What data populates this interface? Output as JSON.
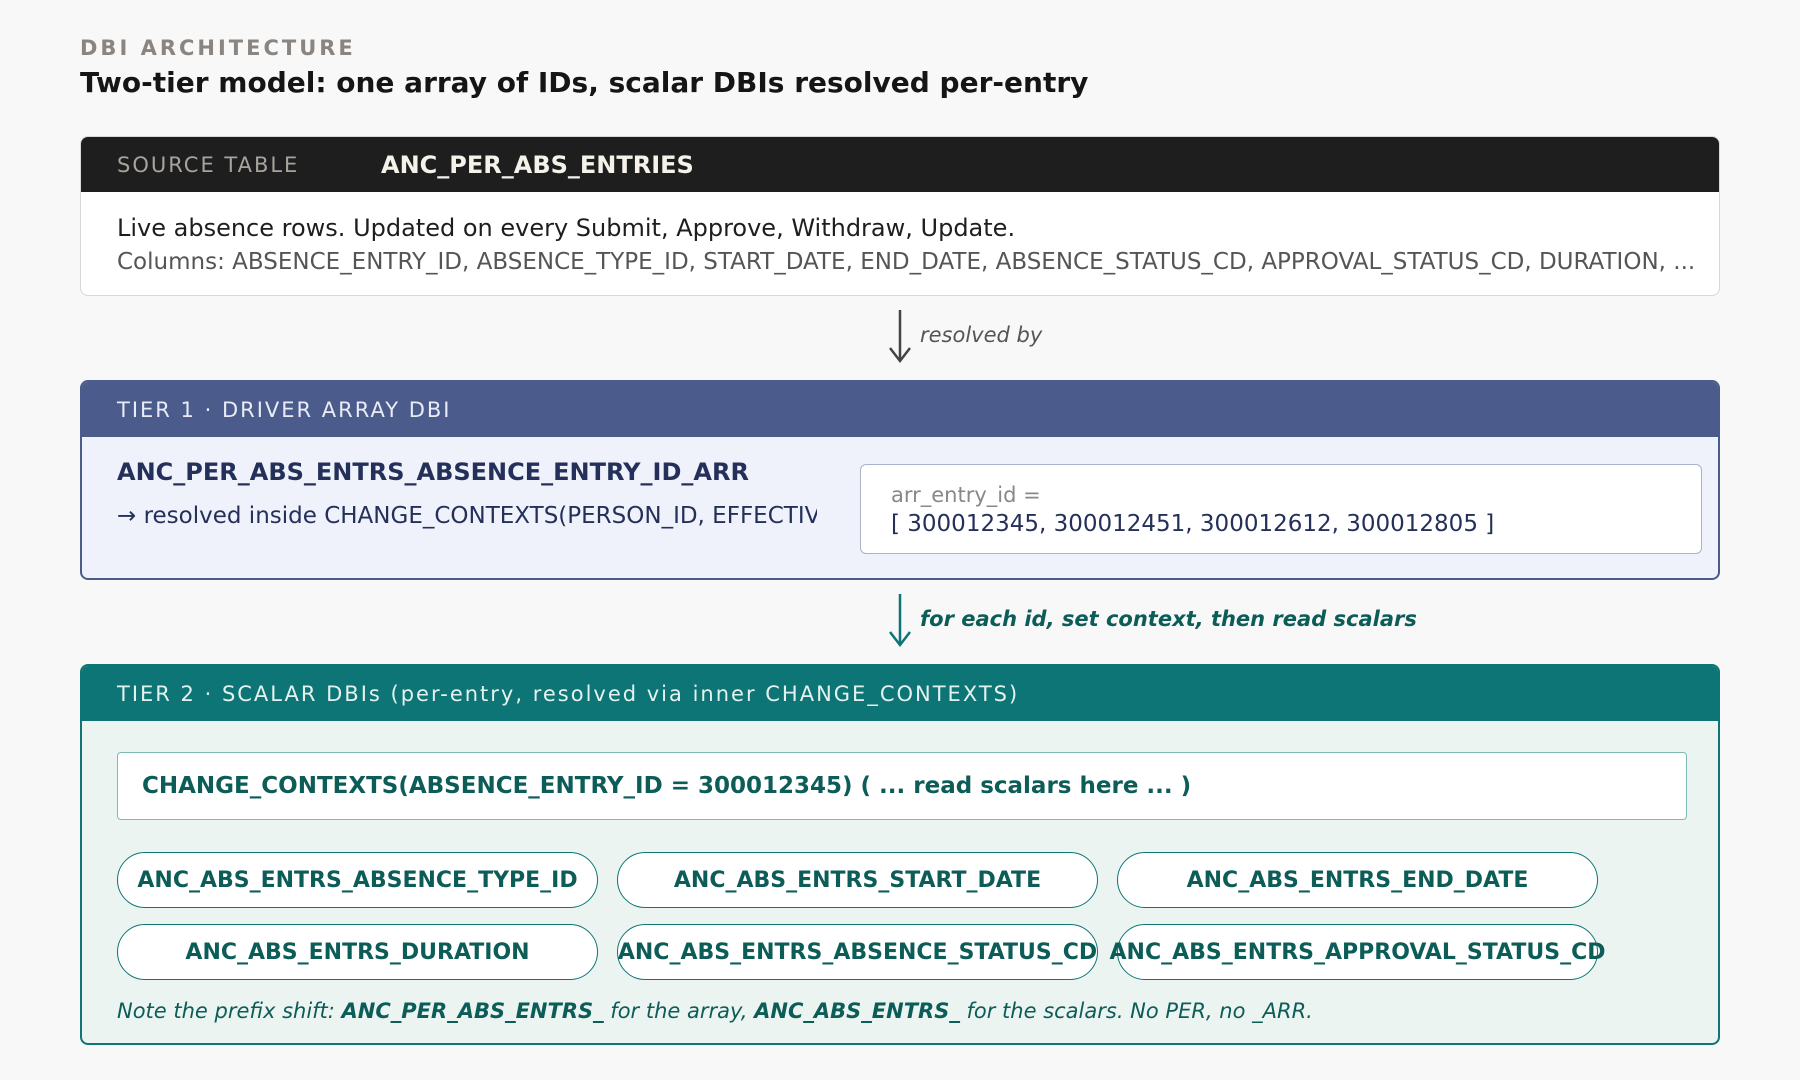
{
  "header": {
    "eyebrow": "DBI ARCHITECTURE",
    "title": "Two-tier model: one array of IDs, scalar DBIs resolved per-entry"
  },
  "source_table": {
    "label": "SOURCE TABLE",
    "name": "ANC_PER_ABS_ENTRIES",
    "description": "Live absence rows. Updated on every Submit, Approve, Withdraw, Update.",
    "columns": "Columns: ABSENCE_ENTRY_ID, ABSENCE_TYPE_ID, START_DATE, END_DATE, ABSENCE_STATUS_CD, APPROVAL_STATUS_CD, DURATION, ..."
  },
  "connectors": {
    "first": "resolved by",
    "second": "for each id, set context, then read scalars"
  },
  "tier1": {
    "header": "TIER 1 · DRIVER ARRAY DBI",
    "dbi_name": "ANC_PER_ABS_ENTRS_ABSENCE_ENTRY_ID_ARR",
    "note": "→ resolved inside CHANGE_CONTEXTS(PERSON_ID, EFFECTIVE_DATE)",
    "array_label": "arr_entry_id =",
    "array_value": "[ 300012345, 300012451, 300012612, 300012805 ]"
  },
  "tier2": {
    "header": "TIER 2 · SCALAR DBIs (per-entry, resolved via inner CHANGE_CONTEXTS)",
    "context_call": "CHANGE_CONTEXTS(ABSENCE_ENTRY_ID = 300012345) ( ... read scalars here ... )",
    "scalars": [
      "ANC_ABS_ENTRS_ABSENCE_TYPE_ID",
      "ANC_ABS_ENTRS_START_DATE",
      "ANC_ABS_ENTRS_END_DATE",
      "ANC_ABS_ENTRS_DURATION",
      "ANC_ABS_ENTRS_ABSENCE_STATUS_CD",
      "ANC_ABS_ENTRS_APPROVAL_STATUS_CD"
    ],
    "note": {
      "part1": "Note the prefix shift: ",
      "prefix_array": "ANC_PER_ABS_ENTRS_",
      "part2": " for the array, ",
      "prefix_scalar": "ANC_ABS_ENTRS_",
      "part3": " for the scalars. No PER, no _ARR."
    }
  },
  "colors": {
    "source_header": "#1e1e1e",
    "tier1_accent": "#4a5b8c",
    "tier1_bg": "#eff2fa",
    "tier2_accent": "#0d7575",
    "tier2_bg": "#ebf4f0",
    "connector_gray": "#444444",
    "connector_teal": "#0d7575"
  }
}
